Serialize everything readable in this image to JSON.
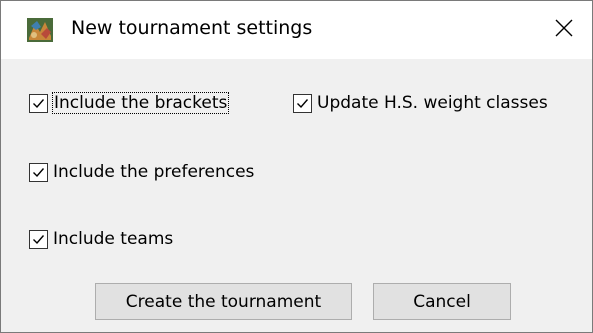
{
  "dialog": {
    "title": "New tournament settings",
    "icon": "app-logo-icon",
    "close_icon": "close-icon"
  },
  "options": {
    "include_brackets": {
      "label": "Include the brackets",
      "checked": true
    },
    "update_weight_classes": {
      "label": "Update H.S. weight classes",
      "checked": true
    },
    "include_preferences": {
      "label": "Include the preferences",
      "checked": true
    },
    "include_teams": {
      "label": "Include teams",
      "checked": true
    }
  },
  "buttons": {
    "create": "Create the tournament",
    "cancel": "Cancel"
  },
  "colors": {
    "titlebar_bg": "#ffffff",
    "client_bg": "#f0f0f0",
    "button_bg": "#e1e1e1",
    "button_border": "#adadad"
  }
}
